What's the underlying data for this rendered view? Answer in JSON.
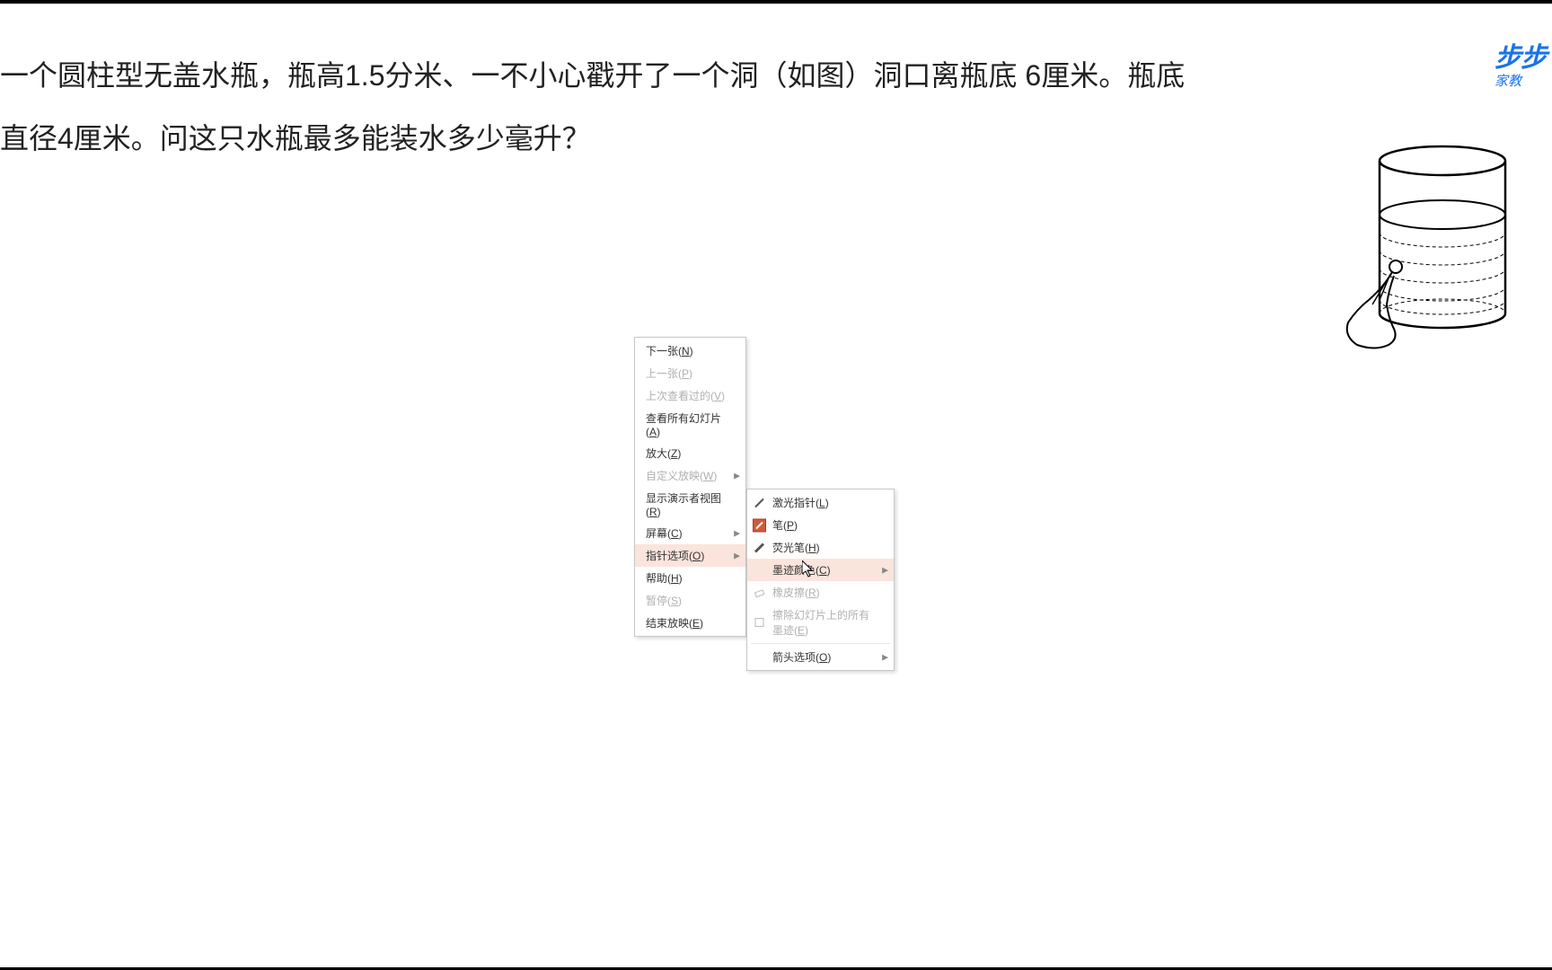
{
  "question": {
    "line1": "一个圆柱型无盖水瓶，瓶高1.5分米、一不小心戳开了一个洞（如图）洞口离瓶底",
    "line2": "6厘米。瓶底直径4厘米。问这只水瓶最多能装水多少毫升？"
  },
  "logo": {
    "main": "步步",
    "sub": "家教"
  },
  "context_menu": {
    "items": [
      {
        "label": "下一张(",
        "key": "N",
        "suffix": ")",
        "disabled": false,
        "arrow": false
      },
      {
        "label": "上一张(",
        "key": "P",
        "suffix": ")",
        "disabled": true,
        "arrow": false
      },
      {
        "label": "上次查看过的(",
        "key": "V",
        "suffix": ")",
        "disabled": true,
        "arrow": false
      },
      {
        "label": "查看所有幻灯片(",
        "key": "A",
        "suffix": ")",
        "disabled": false,
        "arrow": false
      },
      {
        "label": "放大(",
        "key": "Z",
        "suffix": ")",
        "disabled": false,
        "arrow": false
      },
      {
        "label": "自定义放映(",
        "key": "W",
        "suffix": ")",
        "disabled": true,
        "arrow": true
      },
      {
        "label": "显示演示者视图(",
        "key": "R",
        "suffix": ")",
        "disabled": false,
        "arrow": false
      },
      {
        "label": "屏幕(",
        "key": "C",
        "suffix": ")",
        "disabled": false,
        "arrow": true
      },
      {
        "label": "指针选项(",
        "key": "O",
        "suffix": ")",
        "disabled": false,
        "arrow": true,
        "highlighted": true
      },
      {
        "label": "帮助(",
        "key": "H",
        "suffix": ")",
        "disabled": false,
        "arrow": false
      },
      {
        "label": "暂停(",
        "key": "S",
        "suffix": ")",
        "disabled": true,
        "arrow": false
      },
      {
        "label": "结束放映(",
        "key": "E",
        "suffix": ")",
        "disabled": false,
        "arrow": false
      }
    ]
  },
  "submenu": {
    "items": [
      {
        "label": "激光指针(",
        "key": "L",
        "suffix": ")",
        "disabled": false,
        "icon": "laser",
        "arrow": false
      },
      {
        "label": "笔(",
        "key": "P",
        "suffix": ")",
        "disabled": false,
        "icon": "pen",
        "active": true,
        "arrow": false
      },
      {
        "label": "荧光笔(",
        "key": "H",
        "suffix": ")",
        "disabled": false,
        "icon": "highlighter",
        "arrow": false
      },
      {
        "label": "墨迹颜色(",
        "key": "C",
        "suffix": ")",
        "disabled": false,
        "icon": "none",
        "highlighted": true,
        "arrow": true
      },
      {
        "label": "橡皮擦(",
        "key": "R",
        "suffix": ")",
        "disabled": true,
        "icon": "eraser",
        "arrow": false
      },
      {
        "label": "擦除幻灯片上的所有墨迹(",
        "key": "E",
        "suffix": ")",
        "disabled": true,
        "icon": "erase-all",
        "arrow": false
      },
      {
        "label": "箭头选项(",
        "key": "O",
        "suffix": ")",
        "disabled": false,
        "icon": "none",
        "arrow": true
      }
    ]
  }
}
